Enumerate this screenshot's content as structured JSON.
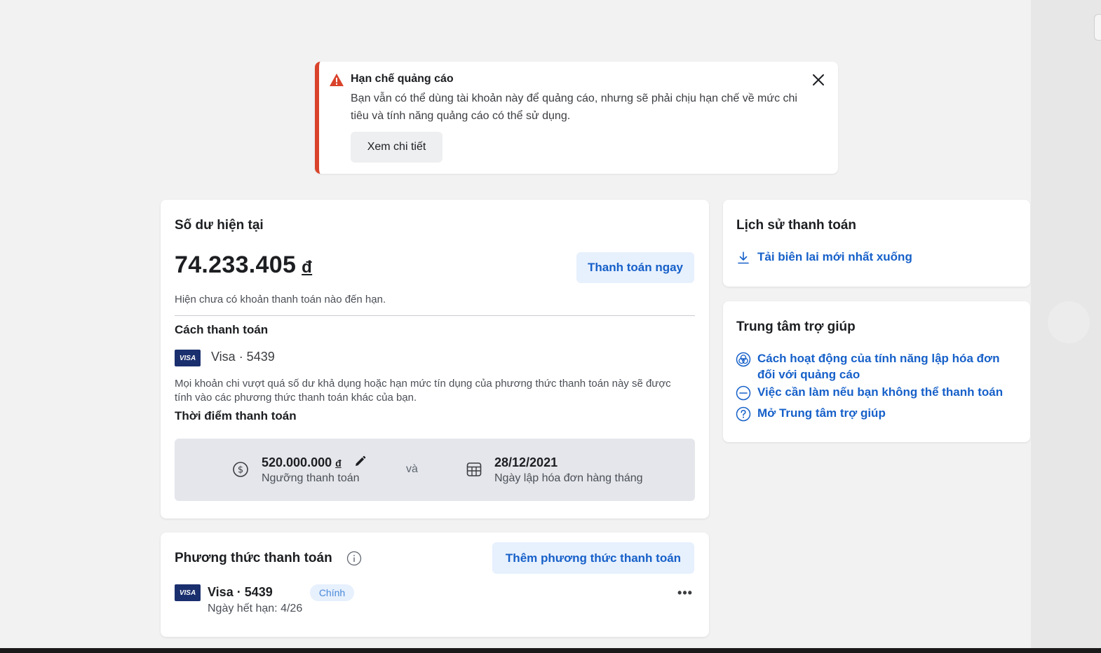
{
  "alert": {
    "title": "Hạn chế quảng cáo",
    "message": "Bạn vẫn có thể dùng tài khoản này để quảng cáo, nhưng sẽ phải chịu hạn chế về mức chi tiêu và tính năng quảng cáo có thể sử dụng.",
    "details_label": "Xem chi tiết",
    "accent_color": "#d9432b",
    "warn_icon": "warning-triangle-icon",
    "close_icon": "close-icon"
  },
  "balance": {
    "heading": "Số dư hiện tại",
    "amount": "74.233.405",
    "currency": "đ",
    "pay_now_label": "Thanh toán ngay",
    "no_due_text": "Hiện chưa có khoản thanh toán nào đến hạn.",
    "payment_method_heading": "Cách thanh toán",
    "card_brand": "VISA",
    "payment_method": "Visa · 5439",
    "note": "Mọi khoản chi vượt quá số dư khả dụng hoặc hạn mức tín dụng của phương thức thanh toán này sẽ được tính vào các phương thức thanh toán khác của bạn.",
    "timing_heading": "Thời điểm thanh toán",
    "threshold_value": "520.000.000",
    "threshold_currency": "đ",
    "threshold_label": "Ngưỡng thanh toán",
    "and_text": "và",
    "billing_date": "28/12/2021",
    "billing_date_label": "Ngày lập hóa đơn hàng tháng"
  },
  "methods": {
    "heading": "Phương thức thanh toán",
    "add_label": "Thêm phương thức thanh toán",
    "items": [
      {
        "brand": "VISA",
        "name": "Visa · 5439",
        "badge": "Chính",
        "expiry": "Ngày hết hạn: 4/26",
        "more": "•••"
      }
    ]
  },
  "history": {
    "heading": "Lịch sử thanh toán",
    "download_link": "Tải biên lai mới nhất xuống"
  },
  "help": {
    "heading": "Trung tâm trợ giúp",
    "links": [
      "Cách hoạt động của tính năng lập hóa đơn đối với quảng cáo",
      "Việc cần làm nếu bạn không thể thanh toán",
      "Mở Trung tâm trợ giúp"
    ]
  },
  "colors": {
    "link": "#1660c9",
    "button_bg": "#e7f0fd",
    "alert_border": "#d9432b",
    "visa_badge": "#1a2f6e"
  }
}
